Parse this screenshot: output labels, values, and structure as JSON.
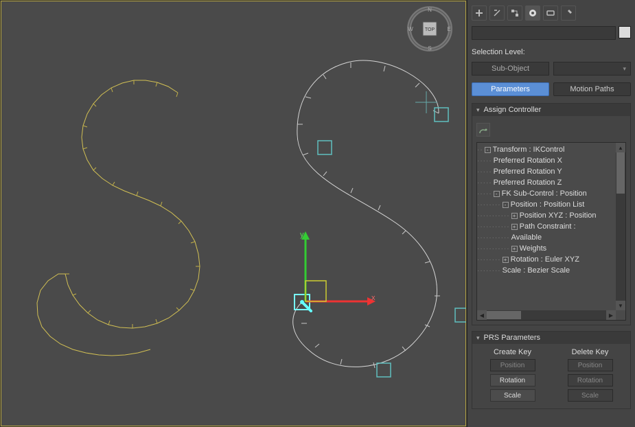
{
  "viewport": {
    "viewcube_face": "TOP",
    "compass": {
      "n": "N",
      "s": "S",
      "e": "E",
      "w": "W"
    },
    "axis_x": "x",
    "axis_y": "y"
  },
  "panel": {
    "selection_level_label": "Selection Level:",
    "sub_object_label": "Sub-Object",
    "tabs": {
      "parameters": "Parameters",
      "motion_paths": "Motion Paths"
    },
    "assign_controller": {
      "title": "Assign Controller",
      "tree": [
        {
          "indent": 0,
          "toggle": "-",
          "label": "Transform : IKControl"
        },
        {
          "indent": 1,
          "toggle": "",
          "label": "Preferred Rotation X"
        },
        {
          "indent": 1,
          "toggle": "",
          "label": "Preferred Rotation Y"
        },
        {
          "indent": 1,
          "toggle": "",
          "label": "Preferred Rotation Z"
        },
        {
          "indent": 1,
          "toggle": "-",
          "label": "FK Sub-Control : Position"
        },
        {
          "indent": 2,
          "toggle": "-",
          "label": "Position : Position List"
        },
        {
          "indent": 3,
          "toggle": "+",
          "label": "Position XYZ : Position"
        },
        {
          "indent": 3,
          "toggle": "+",
          "label": "Path Constraint :"
        },
        {
          "indent": 3,
          "toggle": "",
          "label": "Available"
        },
        {
          "indent": 3,
          "toggle": "+",
          "label": "Weights"
        },
        {
          "indent": 2,
          "toggle": "+",
          "label": "Rotation : Euler XYZ"
        },
        {
          "indent": 2,
          "toggle": "",
          "label": "Scale : Bezier Scale"
        }
      ]
    },
    "prs": {
      "title": "PRS Parameters",
      "create_label": "Create Key",
      "delete_label": "Delete Key",
      "create": {
        "position": "Position",
        "rotation": "Rotation",
        "scale": "Scale"
      },
      "delete": {
        "position": "Position",
        "rotation": "Rotation",
        "scale": "Scale"
      }
    }
  }
}
